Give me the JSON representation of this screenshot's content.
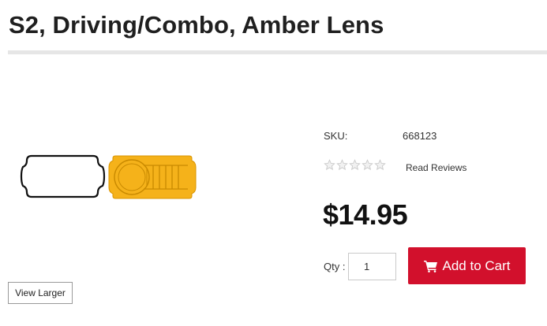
{
  "product": {
    "title": "S2, Driving/Combo, Amber Lens",
    "sku_label": "SKU:",
    "sku": "668123",
    "rating": {
      "stars": 0,
      "max": 5
    },
    "read_reviews": "Read Reviews",
    "price": "$14.95",
    "image_alt": "amber lens and gasket"
  },
  "gallery": {
    "view_larger": "View Larger"
  },
  "purchase": {
    "qty_label": "Qty :",
    "qty_value": "1",
    "add_to_cart": "Add to Cart",
    "cart_icon": "shopping-cart-icon"
  },
  "colors": {
    "accent_red": "#d2102c",
    "lens_amber": "#f5b21a",
    "star_empty": "#cfcfcf"
  }
}
